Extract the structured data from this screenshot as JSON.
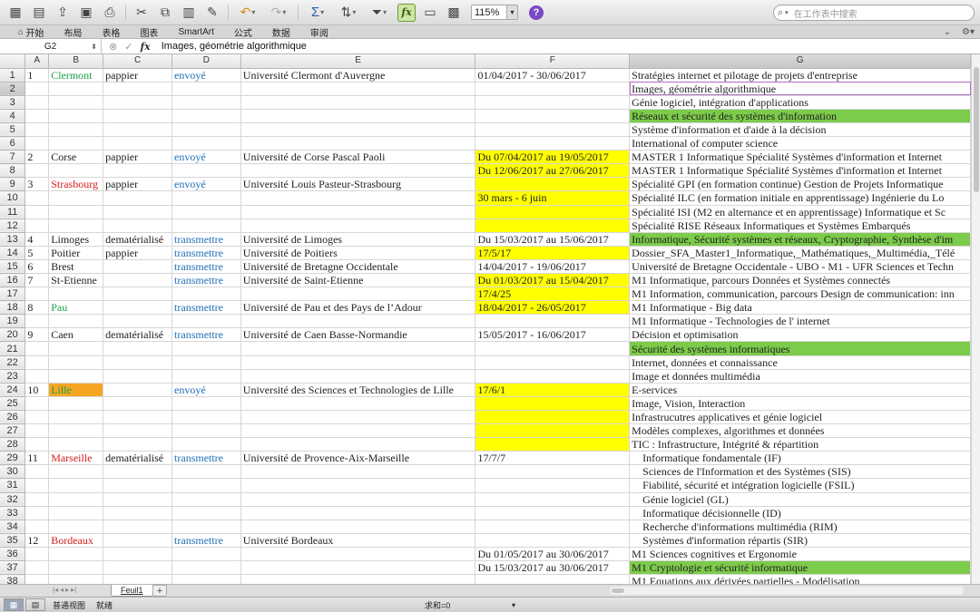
{
  "toolbar": {
    "zoom": "115%",
    "search_placeholder": "在工作表中搜索",
    "help_label": "?"
  },
  "ribbon": {
    "tabs": [
      "开始",
      "布局",
      "表格",
      "图表",
      "SmartArt",
      "公式",
      "数据",
      "审阅"
    ]
  },
  "formula_bar": {
    "name_box": "G2",
    "fx_label": "fx",
    "value": "Images, géométrie algorithmique"
  },
  "columns": [
    "A",
    "B",
    "C",
    "D",
    "E",
    "F",
    "G"
  ],
  "active_cell": {
    "row": 2,
    "col": "G"
  },
  "rows": [
    {
      "n": "1",
      "A": "1",
      "B": "Clermont",
      "Bc": "green",
      "C": "pappier",
      "D": "envoyé",
      "E": "Université Clermont d'Auvergne",
      "F": "01/04/2017 - 30/06/2017",
      "G": "Stratégies internet et pilotage de projets d'entreprise"
    },
    {
      "n": "2",
      "G": "Images, géométrie algorithmique"
    },
    {
      "n": "3",
      "G": "Génie logiciel, intégration d'applications"
    },
    {
      "n": "4",
      "G": "Réseaux et sécurité des systèmes d'information",
      "Gbg": "gr"
    },
    {
      "n": "5",
      "G": "Système d'information et d'aide à la décision"
    },
    {
      "n": "6",
      "G": "International of computer science"
    },
    {
      "n": "7",
      "A": "2",
      "B": "Corse",
      "C": "pappier",
      "D": "envoyé",
      "E": "Université de Corse Pascal Paoli",
      "F": "Du 07/04/2017 au 19/05/2017",
      "Fbg": "y",
      "G": "MASTER 1 Informatique Spécialité Systèmes d'information et Internet"
    },
    {
      "n": "8",
      "F": "Du 12/06/2017 au 27/06/2017",
      "Fbg": "y",
      "G": "MASTER 1 Informatique Spécialité Systèmes d'information et Internet"
    },
    {
      "n": "9",
      "A": "3",
      "B": "Strasbourg",
      "Bc": "red",
      "C": "pappier",
      "D": "envoyé",
      "E": "Université Louis Pasteur-Strasbourg",
      "Fbg": "y",
      "G": "Spécialité GPI (en formation continue)    Gestion de Projets Informatique"
    },
    {
      "n": "10",
      "F": "30 mars - 6 juin",
      "Fbg": "y",
      "G": "Spécialité ILC (en formation initiale en apprentissage)    Ingénierie du Lo"
    },
    {
      "n": "11",
      "Fbg": "y",
      "G": "Spécialité ISI (M2 en alternance et en apprentissage)    Informatique et Sc"
    },
    {
      "n": "12",
      "Fbg": "y",
      "G": "Spécialité RISE    Réseaux Informatiques et Systèmes Embarqués"
    },
    {
      "n": "13",
      "A": "4",
      "B": "Limoges",
      "C": "dematérialisé",
      "D": "transmettre",
      "E": "Université de Limoges",
      "F": "Du 15/03/2017 au 15/06/2017",
      "G": "Informatique, Sécurité systèmes et réseaux, Cryptographie, Synthèse d'im",
      "Gbg": "gr"
    },
    {
      "n": "14",
      "A": "5",
      "B": "Poitier",
      "C": "pappier",
      "D": "transmettre",
      "E": "Université de Poitiers",
      "F": "17/5/17",
      "Fbg": "y",
      "G": "Dossier_SFA_Master1_Informatique,_Mathématiques,_Multimédia,_Télé"
    },
    {
      "n": "15",
      "A": "6",
      "B": "Brest",
      "D": "transmettre",
      "E": "Université de Bretagne Occidentale",
      "F": "14/04/2017 - 19/06/2017",
      "G": "Université de Bretagne Occidentale - UBO - M1 - UFR Sciences et Techn"
    },
    {
      "n": "16",
      "A": "7",
      "B": "St-Etienne",
      "D": "transmettre",
      "E": "Université de Saint-Etienne",
      "F": "Du 01/03/2017 au 15/04/2017",
      "Fbg": "y",
      "G": "M1 Informatique, parcours Données et Systèmes connectés"
    },
    {
      "n": "17",
      "F": "17/4/25",
      "Fbg": "y",
      "G": "M1 Information, communication, parcours Design de communication: inn"
    },
    {
      "n": "18",
      "A": "8",
      "B": "Pau",
      "Bc": "green",
      "D": "transmettre",
      "E": "Université de Pau et des Pays de l’Adour",
      "F": "18/04/2017 - 26/05/2017",
      "Fbg": "y",
      "G": "M1 Informatique - Big data"
    },
    {
      "n": "19",
      "G": "M1 Informatique - Technologies de l' internet"
    },
    {
      "n": "20",
      "A": "9",
      "B": "Caen",
      "C": "dematérialisé",
      "D": "transmettre",
      "E": "Université de Caen Basse-Normandie",
      "F": "15/05/2017 - 16/06/2017",
      "G": "Décision et optimisation"
    },
    {
      "n": "21",
      "G": "Sécurité des systèmes informatiques",
      "Gbg": "gr"
    },
    {
      "n": "22",
      "G": "Internet, données et connaissance"
    },
    {
      "n": "23",
      "G": "Image et données multimédia"
    },
    {
      "n": "24",
      "A": "10",
      "B": "Lille",
      "Bc": "green",
      "Bbg": "or",
      "D": "envoyé",
      "E": "Université des Sciences et Technologies de Lille",
      "F": "17/6/1",
      "Fbg": "y",
      "G": "E-services"
    },
    {
      "n": "25",
      "Fbg": "y",
      "G": "Image, Vision, Interaction"
    },
    {
      "n": "26",
      "Fbg": "y",
      "G": "Infrastrucutres applicatives et génie logiciel"
    },
    {
      "n": "27",
      "Fbg": "y",
      "G": "Modèles complexes, algorithmes et données"
    },
    {
      "n": "28",
      "Fbg": "y",
      "G": "TIC : Infrastructure, Intégrité & répartition"
    },
    {
      "n": "29",
      "A": "11",
      "B": "Marseille",
      "Bc": "red",
      "C": "dematérialisé",
      "D": "transmettre",
      "E": "Université de Provence-Aix-Marseille",
      "F": "17/7/7",
      "G": "Informatique fondamentale (IF)",
      "Gind": true
    },
    {
      "n": "30",
      "G": "Sciences de l'Information et des Systèmes (SIS)",
      "Gind": true
    },
    {
      "n": "31",
      "G": "Fiabilité, sécurité et intégration logicielle (FSIL)",
      "Gind": true
    },
    {
      "n": "32",
      "G": "Génie logiciel (GL)",
      "Gind": true
    },
    {
      "n": "33",
      "G": "Informatique décisionnelle (ID)",
      "Gind": true
    },
    {
      "n": "34",
      "G": "Recherche d'informations multimédia (RIM)",
      "Gind": true
    },
    {
      "n": "35",
      "A": "12",
      "B": "Bordeaux",
      "Bc": "red",
      "D": "transmettre",
      "E": "Université Bordeaux",
      "G": "Systèmes d'information répartis (SIR)",
      "Gind": true
    },
    {
      "n": "36",
      "F": "Du 01/05/2017 au 30/06/2017",
      "G": "M1 Sciences cognitives et Ergonomie"
    },
    {
      "n": "37",
      "F": "Du 15/03/2017 au 30/06/2017",
      "G": "M1 Cryptologie et sécurité informatique",
      "Gbg": "gr"
    },
    {
      "n": "38",
      "G": "M1 Equations aux dérivées partielles - Modélisation"
    }
  ],
  "sheet_tabs": [
    "Feuil1"
  ],
  "status": {
    "view_label": "普通视图",
    "ready": "就绪",
    "sum": "求和=0"
  }
}
